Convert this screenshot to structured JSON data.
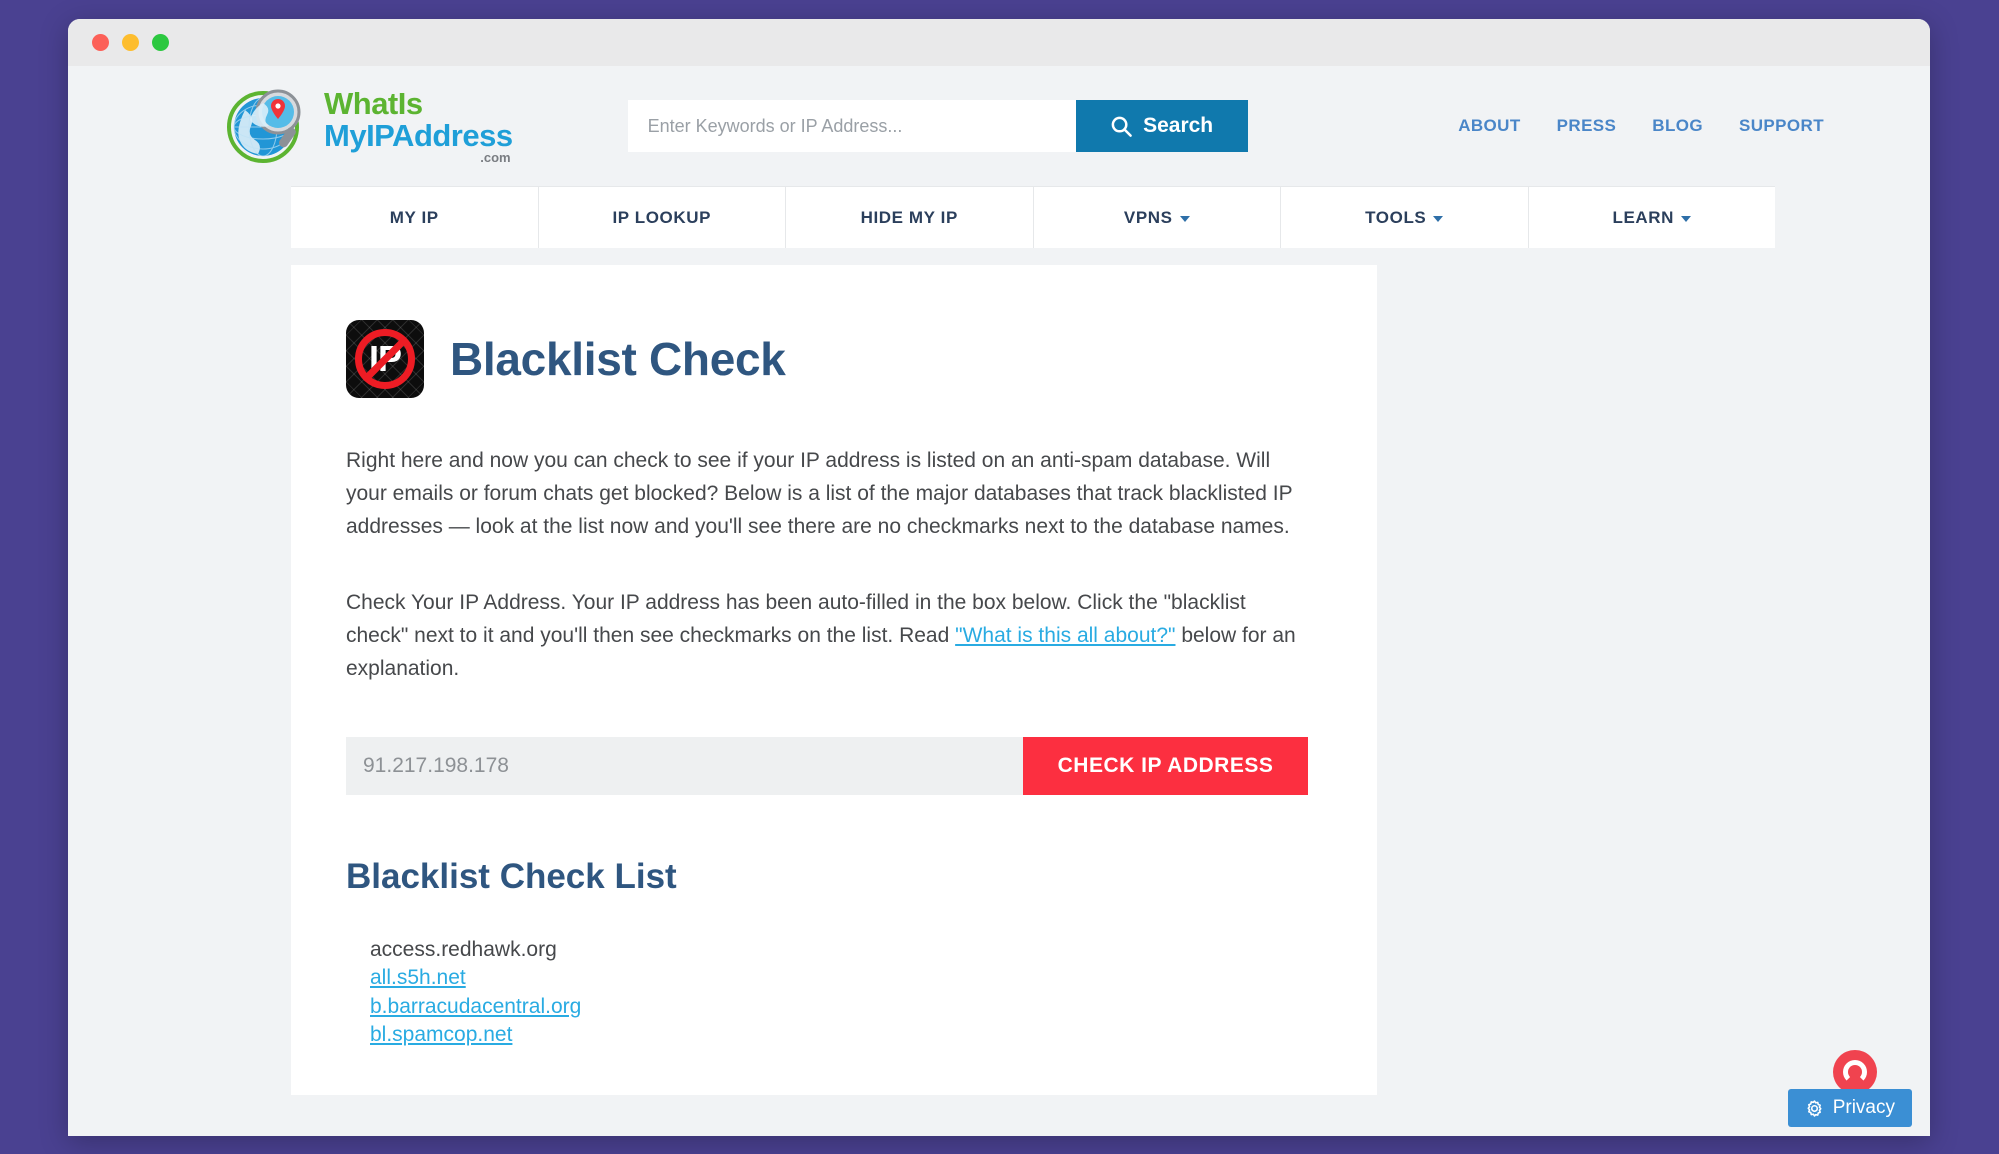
{
  "window": {
    "traffic_lights": [
      "close",
      "minimize",
      "maximize"
    ]
  },
  "header": {
    "logo": {
      "line1": "WhatIs",
      "line2": "MyIPAddress",
      "tld": ".com",
      "icon": "globe-magnifier-icon"
    },
    "search": {
      "placeholder": "Enter Keywords or IP Address...",
      "value": "",
      "button_label": "Search",
      "button_icon": "search-icon"
    },
    "top_links": [
      {
        "label": "ABOUT"
      },
      {
        "label": "PRESS"
      },
      {
        "label": "BLOG"
      },
      {
        "label": "SUPPORT"
      }
    ]
  },
  "mainnav": [
    {
      "label": "MY IP",
      "has_caret": false
    },
    {
      "label": "IP LOOKUP",
      "has_caret": false
    },
    {
      "label": "HIDE MY IP",
      "has_caret": false
    },
    {
      "label": "VPNS",
      "has_caret": true
    },
    {
      "label": "TOOLS",
      "has_caret": true
    },
    {
      "label": "LEARN",
      "has_caret": true
    }
  ],
  "main": {
    "page_icon": {
      "letters": "IP",
      "name": "blocked-ip-icon"
    },
    "page_title": "Blacklist Check",
    "paragraph_1": "Right here and now you can check to see if your IP address is listed on an anti-spam database. Will your emails or forum chats get blocked? Below is a list of the major databases that track blacklisted IP addresses — look at the list now and you'll see there are no checkmarks next to the database names.",
    "paragraph_2": {
      "before_link": "Check Your IP Address. Your IP address has been auto-filled in the box below. Click the \"blacklist check\" next to it and you'll then see checkmarks on the list. Read ",
      "link_text": "\"What is this all about?\"",
      "after_link": " below for an explanation."
    },
    "ip_check": {
      "value": "91.217.198.178",
      "placeholder": "91.217.198.178",
      "button_label": "CHECK IP ADDRESS"
    },
    "list_heading": "Blacklist Check List",
    "blacklist_items": [
      {
        "label": "access.redhawk.org",
        "is_link": false
      },
      {
        "label": "all.s5h.net",
        "is_link": true
      },
      {
        "label": "b.barracudacentral.org",
        "is_link": true
      },
      {
        "label": "bl.spamcop.net",
        "is_link": true
      }
    ]
  },
  "widgets": {
    "support_icon": "support-circle-icon",
    "privacy_label": "Privacy",
    "privacy_icon": "gear-icon"
  },
  "colors": {
    "desktop_background": "#4a4191",
    "brand_blue": "#1079ad",
    "brand_green": "#5cb431",
    "heading_blue": "#2f5680",
    "link_blue": "#29abe2",
    "cta_red": "#fc2f40",
    "nav_text": "#2b3f5c",
    "privacy_blue": "#3b8fd4"
  }
}
